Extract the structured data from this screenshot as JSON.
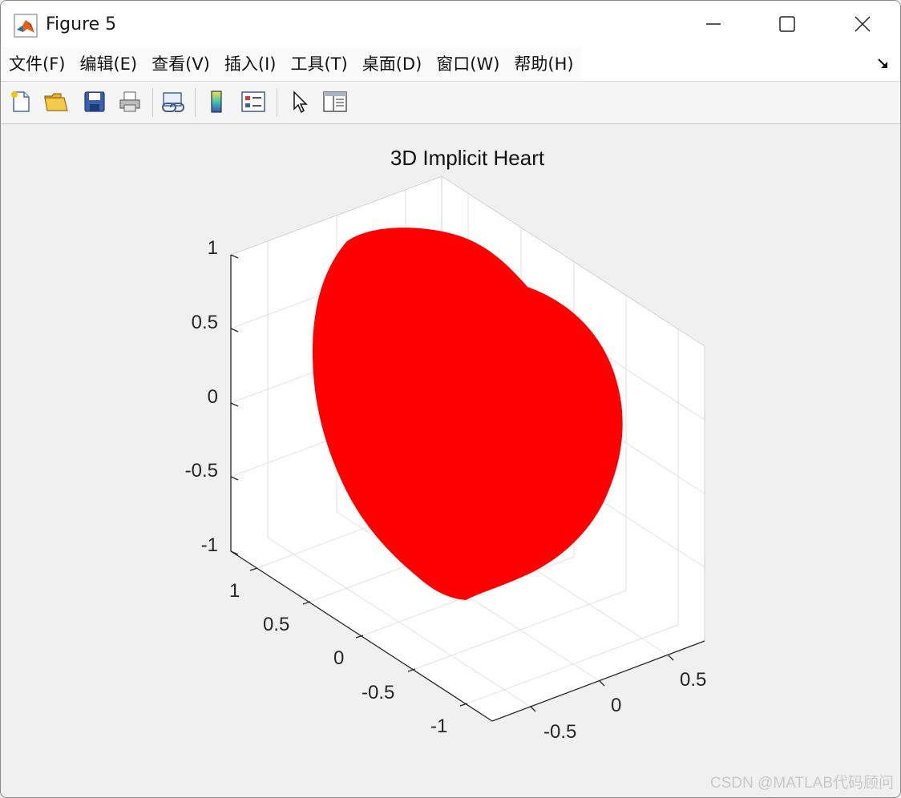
{
  "window": {
    "title": "Figure 5"
  },
  "menu": {
    "items": [
      "文件(F)",
      "编辑(E)",
      "查看(V)",
      "插入(I)",
      "工具(T)",
      "桌面(D)",
      "窗口(W)",
      "帮助(H)"
    ]
  },
  "toolbar": {
    "buttons": [
      "new-figure-icon",
      "open-file-icon",
      "save-icon",
      "print-icon",
      "link-plot-icon",
      "colorbar-icon",
      "legend-icon",
      "pointer-icon",
      "property-inspector-icon"
    ]
  },
  "plot": {
    "title": "3D Implicit Heart",
    "surface_color": "#ff0000",
    "z_ticks": [
      "1",
      "0.5",
      "0",
      "-0.5",
      "-1"
    ],
    "y_ticks": [
      "1",
      "0.5",
      "0",
      "-0.5",
      "-1"
    ],
    "x_ticks": [
      "0.5",
      "0",
      "-0.5"
    ]
  },
  "watermark": "CSDN @MATLAB代码顾问"
}
